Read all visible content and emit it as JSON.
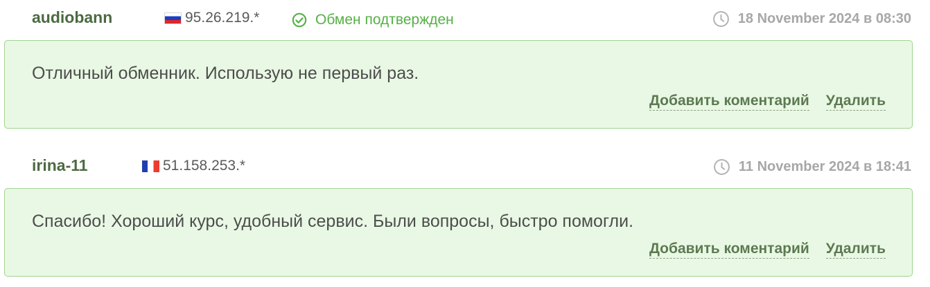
{
  "reviews": [
    {
      "author": "audiobann",
      "flag": "ru-flag",
      "ip": "95.26.219.*",
      "status": "Обмен подтвержден",
      "date": "18 November 2024 в 08:30",
      "text": "Отличный обменник. Использую не первый раз.",
      "add_comment": "Добавить коментарий",
      "delete": "Удалить"
    },
    {
      "author": "irina-11",
      "flag": "fr-flag",
      "ip": "51.158.253.*",
      "date": "11 November 2024 в 18:41",
      "text": "Спасибо! Хороший курс, удобный сервис. Были вопросы, быстро помогли.",
      "add_comment": "Добавить коментарий",
      "delete": "Удалить"
    }
  ],
  "colors": {
    "author": "#4c6a42",
    "confirmed": "#56b046",
    "date": "#a7a7a7",
    "box_bg": "#e9f8e4",
    "box_border": "#9fd490",
    "link": "#5c7a52"
  }
}
